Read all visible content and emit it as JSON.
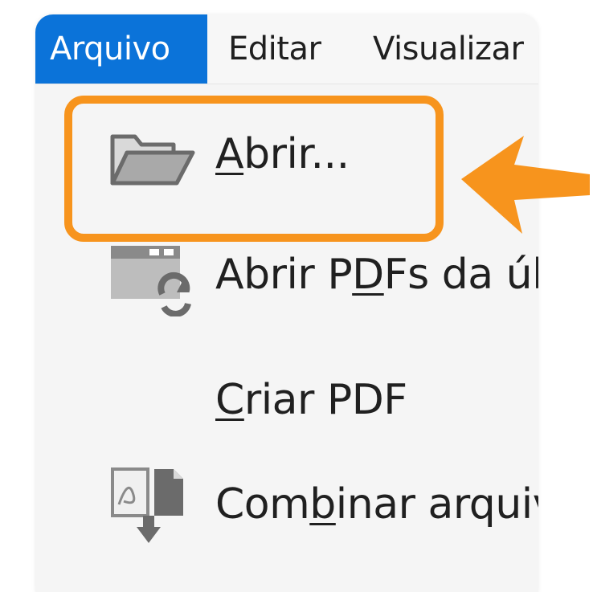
{
  "menubar": {
    "items": [
      {
        "label": "Arquivo",
        "active": true
      },
      {
        "label": "Editar",
        "active": false
      },
      {
        "label": "Visualizar",
        "active": false
      }
    ]
  },
  "menu": {
    "items": [
      {
        "pre": "",
        "underline": "A",
        "post": "brir...",
        "icon": "folder-open-icon"
      },
      {
        "pre": "Abrir P",
        "underline": "D",
        "post": "Fs da úl",
        "icon": "reopen-pdfs-icon"
      },
      {
        "pre": "",
        "underline": "C",
        "post": "riar PDF",
        "icon": ""
      },
      {
        "pre": "Com",
        "underline": "b",
        "post": "inar arquiv",
        "icon": "combine-files-icon"
      }
    ]
  },
  "colors": {
    "menubar_active_bg": "#0b73d9",
    "highlight": "#f7941d",
    "menu_bg": "#f5f5f5"
  }
}
